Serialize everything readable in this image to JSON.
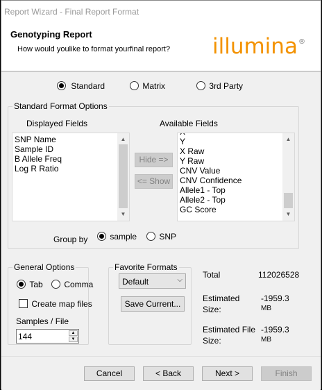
{
  "window": {
    "title": "Report Wizard - Final Report Format"
  },
  "header": {
    "title": "Genotyping Report",
    "subtitle": "How would youlike to format yourfinal report?",
    "logo_text": "illumina",
    "logo_mark": "®",
    "logo_color": "#f39200"
  },
  "format_type": {
    "options": [
      "Standard",
      "Matrix",
      "3rd Party"
    ],
    "selected": "Standard"
  },
  "standard_options": {
    "legend": "Standard Format Options",
    "displayed_label": "Displayed Fields",
    "available_label": "Available Fields",
    "displayed_fields": [
      "SNP Name",
      "Sample ID",
      "B Allele Freq",
      "Log R Ratio"
    ],
    "available_partial_top": "X",
    "available_fields": [
      "X",
      "Y",
      "X Raw",
      "Y Raw",
      "CNV Value",
      "CNV Confidence",
      "Allele1 - Top",
      "Allele2 - Top",
      "GC Score"
    ],
    "hide_button": "Hide =>",
    "show_button": "<= Show",
    "group_by_label": "Group  by",
    "group_by_options": [
      "sample",
      "SNP"
    ],
    "group_by_selected": "sample"
  },
  "general_options": {
    "legend": "General Options",
    "delimiter_options": [
      "Tab",
      "Comma"
    ],
    "delimiter_selected": "Tab",
    "create_map_files_label": "Create map files",
    "create_map_files_checked": false,
    "samples_per_file_label": "Samples / File",
    "samples_per_file_value": "144"
  },
  "favorite_formats": {
    "legend": "Favorite Formats",
    "selected": "Default",
    "save_button": "Save Current..."
  },
  "summary": {
    "total_label": "Total",
    "total_value": "112026528",
    "est_size_label_1": "Estimated",
    "est_size_label_2": "Size:",
    "est_size_value": "-1959.3",
    "est_size_unit_partial": "MB",
    "est_file_label_1": "Estimated File",
    "est_file_label_2": "Size:",
    "est_file_value": "-1959.3",
    "est_file_unit_partial": "MB"
  },
  "footer": {
    "cancel": "Cancel",
    "back": "< Back",
    "next": "Next >",
    "finish": "Finish"
  }
}
